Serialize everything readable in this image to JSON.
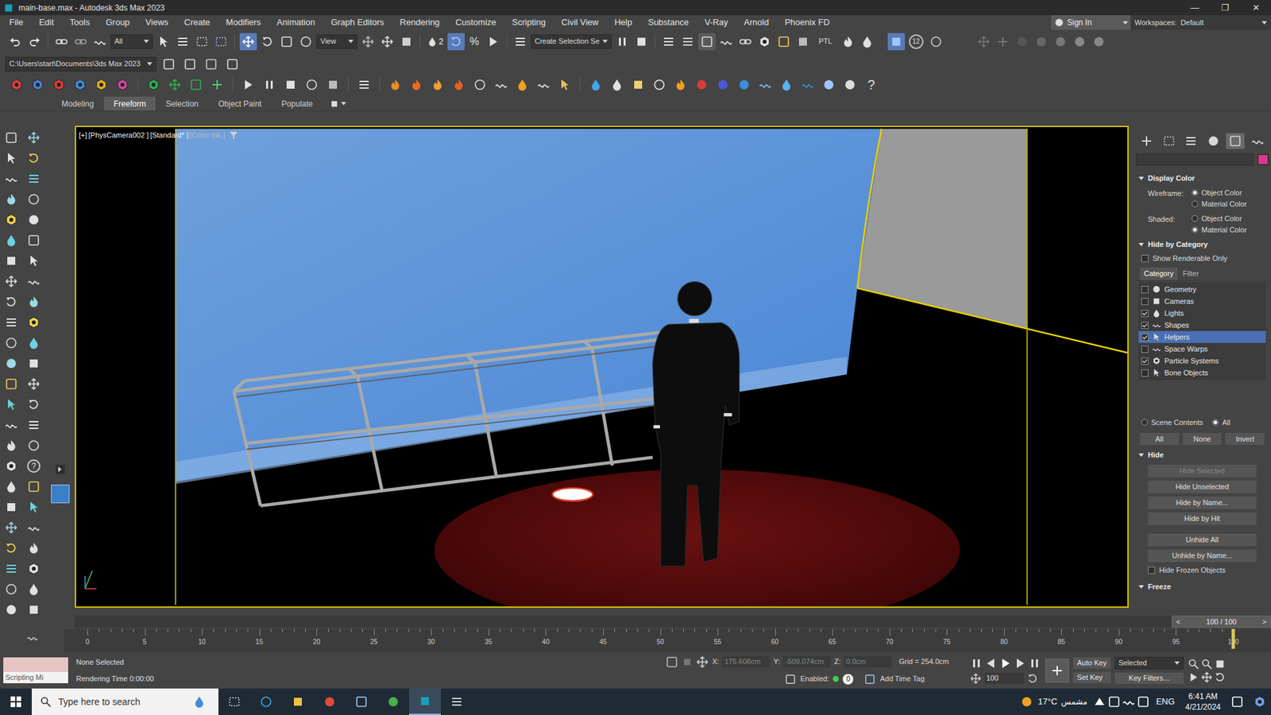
{
  "window": {
    "title": "main-base.max - Autodesk 3ds Max 2023",
    "controls": [
      "—",
      "❐",
      "✕"
    ]
  },
  "menu": [
    "File",
    "Edit",
    "Tools",
    "Group",
    "Views",
    "Create",
    "Modifiers",
    "Animation",
    "Graph Editors",
    "Rendering",
    "Customize",
    "Scripting",
    "Civil View",
    "Help",
    "Substance",
    "V-Ray",
    "Arnold",
    "Phoenix FD"
  ],
  "account": {
    "sign_in": "Sign In",
    "workspaces_label": "Workspaces:",
    "workspace": "Default"
  },
  "main_toolbar": {
    "selection_filter": "All",
    "reference_coord": "View",
    "snap": "2",
    "percent": "%",
    "selection_set": "Create Selection Se",
    "ptl": "PTL",
    "badge": "12"
  },
  "project_path": "C:\\Users\\start\\Documents\\3ds Max 2023",
  "toolbar3_help": "?",
  "ribbon_tabs": [
    {
      "label": "Modeling",
      "selected": false
    },
    {
      "label": "Freeform",
      "selected": true
    },
    {
      "label": "Selection",
      "selected": false
    },
    {
      "label": "Object Paint",
      "selected": false
    },
    {
      "label": "Populate",
      "selected": false
    }
  ],
  "left_help": "?",
  "viewport": {
    "labels": [
      "[+]",
      "[PhysCamera002 ]",
      "[Standard* ]",
      "[Color Ink ]"
    ],
    "active": true
  },
  "command_panel": {
    "tabs": [
      {
        "selected": false
      },
      {
        "selected": false
      },
      {
        "selected": false
      },
      {
        "selected": false
      },
      {
        "selected": true
      },
      {
        "selected": false
      }
    ],
    "display_color": {
      "title": "Display Color",
      "groups": [
        {
          "label": "Wireframe:",
          "options": [
            {
              "label": "Object Color",
              "selected": true
            },
            {
              "label": "Material Color",
              "selected": false
            }
          ]
        },
        {
          "label": "Shaded:",
          "options": [
            {
              "label": "Object Color",
              "selected": false
            },
            {
              "label": "Material Color",
              "selected": true
            }
          ]
        }
      ]
    },
    "hide_by_category": {
      "title": "Hide by Category",
      "renderable_only": {
        "label": "Show Renderable Only",
        "checked": false
      },
      "tabs": [
        {
          "label": "Category",
          "selected": true
        },
        {
          "label": "Filter",
          "selected": false
        }
      ],
      "categories": [
        {
          "label": "Geometry",
          "checked": false,
          "selected": false
        },
        {
          "label": "Cameras",
          "checked": false,
          "selected": false
        },
        {
          "label": "Lights",
          "checked": true,
          "selected": false
        },
        {
          "label": "Shapes",
          "checked": true,
          "selected": false
        },
        {
          "label": "Helpers",
          "checked": true,
          "selected": true
        },
        {
          "label": "Space Warps",
          "checked": false,
          "selected": false
        },
        {
          "label": "Particle Systems",
          "checked": true,
          "selected": false
        },
        {
          "label": "Bone Objects",
          "checked": false,
          "selected": false
        }
      ],
      "scope": [
        {
          "label": "Scene Contents",
          "selected": false
        },
        {
          "label": "All",
          "selected": true
        }
      ],
      "buttons": [
        "All",
        "None",
        "Invert"
      ]
    },
    "hide": {
      "title": "Hide",
      "buttons": [
        {
          "label": "Hide Selected",
          "disabled": true
        },
        {
          "label": "Hide Unselected",
          "disabled": false
        },
        {
          "label": "Hide by Name...",
          "disabled": false
        },
        {
          "label": "Hide by Hit",
          "disabled": false
        },
        {
          "label": "Unhide All",
          "disabled": false
        },
        {
          "label": "Unhide by Name...",
          "disabled": false
        }
      ],
      "hide_frozen": {
        "label": "Hide Frozen Objects",
        "checked": false
      }
    },
    "freeze": {
      "title": "Freeze"
    }
  },
  "time_slider": {
    "prev": "<",
    "reading": "100 / 100",
    "next": ">",
    "level": 1
  },
  "timeline": {
    "ticks": [
      "0",
      "5",
      "10",
      "15",
      "20",
      "25",
      "30",
      "35",
      "40",
      "45",
      "50",
      "55",
      "60",
      "65",
      "70",
      "75",
      "80",
      "85",
      "90",
      "95",
      "100"
    ]
  },
  "status": {
    "listener": "Scripting Mi",
    "selection": "None Selected",
    "render_time": "Rendering Time 0:00:00",
    "x_label": "X:",
    "x": "175.608cm",
    "y_label": "Y:",
    "y": "-509.074cm",
    "z_label": "Z:",
    "z": "0.0cm",
    "coords_disabled": true,
    "grid": "Grid = 254.0cm",
    "enabled_label": "Enabled:",
    "enabled": true,
    "tag_toggle": "0",
    "add_time_tag": "Add Time Tag"
  },
  "anim_controls": {
    "frame": "100",
    "auto_key": "Auto Key",
    "key_mode": "Selected",
    "set_key": "Set Key",
    "key_filters": "Key Filters..."
  },
  "taskbar": {
    "search_placeholder": "Type here to search",
    "temperature": "17°C",
    "weather": "مشمس",
    "language": "ENG",
    "time": "6:41 AM",
    "date": "4/21/2024"
  }
}
